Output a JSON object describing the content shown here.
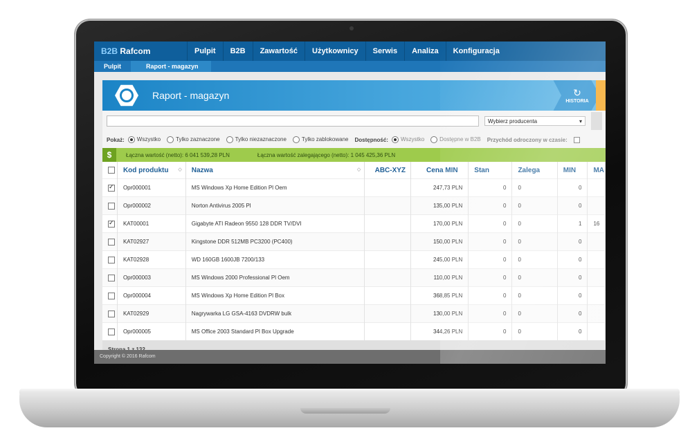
{
  "app": {
    "logo_prefix": "B2B",
    "logo_name": "Rafcom"
  },
  "nav": {
    "items": [
      "Pulpit",
      "B2B",
      "Zawartość",
      "Użytkownicy",
      "Serwis",
      "Analiza",
      "Konfiguracja"
    ]
  },
  "breadcrumb": {
    "items": [
      "Pulpit",
      "Raport - magazyn"
    ]
  },
  "page": {
    "title": "Raport - magazyn",
    "history_label": "HISTORIA"
  },
  "search": {
    "value": "",
    "producer_placeholder": "Wybierz producenta"
  },
  "filters": {
    "show_label": "Pokaż:",
    "show_options": [
      "Wszystko",
      "Tylko zaznaczone",
      "Tylko niezaznaczone",
      "Tylko zablokowane"
    ],
    "availability_label": "Dostępność:",
    "availability_options": [
      "Wszystko",
      "Dostępne w B2B"
    ],
    "delayed_label": "Przychód odroczony w czasie:"
  },
  "summary": {
    "icon": "$",
    "total_value": "Łączna wartość (netto): 6 041 539,28 PLN",
    "stale_value": "Łączna wartość zalegającego (netto): 1 045 425,36 PLN"
  },
  "table": {
    "columns": [
      "Kod produktu",
      "Nazwa",
      "ABC-XYZ",
      "Cena MIN",
      "Stan",
      "Zalega",
      "MIN",
      "MA"
    ],
    "rows": [
      {
        "checked": true,
        "code": "Opr000001",
        "name": "MS Windows Xp Home Edition Pl Oem",
        "abc": "",
        "price": "247,73 PLN",
        "stan": "0",
        "zalega": "0",
        "min": "0",
        "ma": ""
      },
      {
        "checked": false,
        "code": "Opr000002",
        "name": "Norton Antivirus 2005 Pl",
        "abc": "",
        "price": "135,00 PLN",
        "stan": "0",
        "zalega": "0",
        "min": "0",
        "ma": ""
      },
      {
        "checked": true,
        "code": "KAT00001",
        "name": "Gigabyte ATI Radeon 9550 128 DDR TV/DVI",
        "abc": "",
        "price": "170,00 PLN",
        "stan": "0",
        "zalega": "0",
        "min": "1",
        "ma": "16"
      },
      {
        "checked": false,
        "code": "KAT02927",
        "name": "Kingstone DDR 512MB PC3200 (PC400)",
        "abc": "",
        "price": "150,00 PLN",
        "stan": "0",
        "zalega": "0",
        "min": "0",
        "ma": ""
      },
      {
        "checked": false,
        "code": "KAT02928",
        "name": "WD 160GB 1600JB 7200/133",
        "abc": "",
        "price": "245,00 PLN",
        "stan": "0",
        "zalega": "0",
        "min": "0",
        "ma": ""
      },
      {
        "checked": false,
        "code": "Opr000003",
        "name": "MS Windows 2000 Professional Pl Oem",
        "abc": "",
        "price": "110,00 PLN",
        "stan": "0",
        "zalega": "0",
        "min": "0",
        "ma": ""
      },
      {
        "checked": false,
        "code": "Opr000004",
        "name": "MS Windows Xp Home Edition Pl Box",
        "abc": "",
        "price": "368,85 PLN",
        "stan": "0",
        "zalega": "0",
        "min": "0",
        "ma": ""
      },
      {
        "checked": false,
        "code": "KAT02929",
        "name": "Nagrywarka LG GSA-4163 DVDRW bulk",
        "abc": "",
        "price": "130,00 PLN",
        "stan": "0",
        "zalega": "0",
        "min": "0",
        "ma": ""
      },
      {
        "checked": false,
        "code": "Opr000005",
        "name": "MS Office 2003 Standard Pl Box Upgrade",
        "abc": "",
        "price": "344,26 PLN",
        "stan": "0",
        "zalega": "0",
        "min": "0",
        "ma": ""
      }
    ]
  },
  "pager": {
    "text": "Strona 1 z 132"
  },
  "footer": {
    "text": "Copyright © 2016 Rafcom"
  },
  "colors": {
    "nav_bg": "#0f5f9c",
    "banner_bg": "#1b84c6",
    "summary_bg": "#9ecb4c",
    "accent_orange": "#f5a623"
  }
}
